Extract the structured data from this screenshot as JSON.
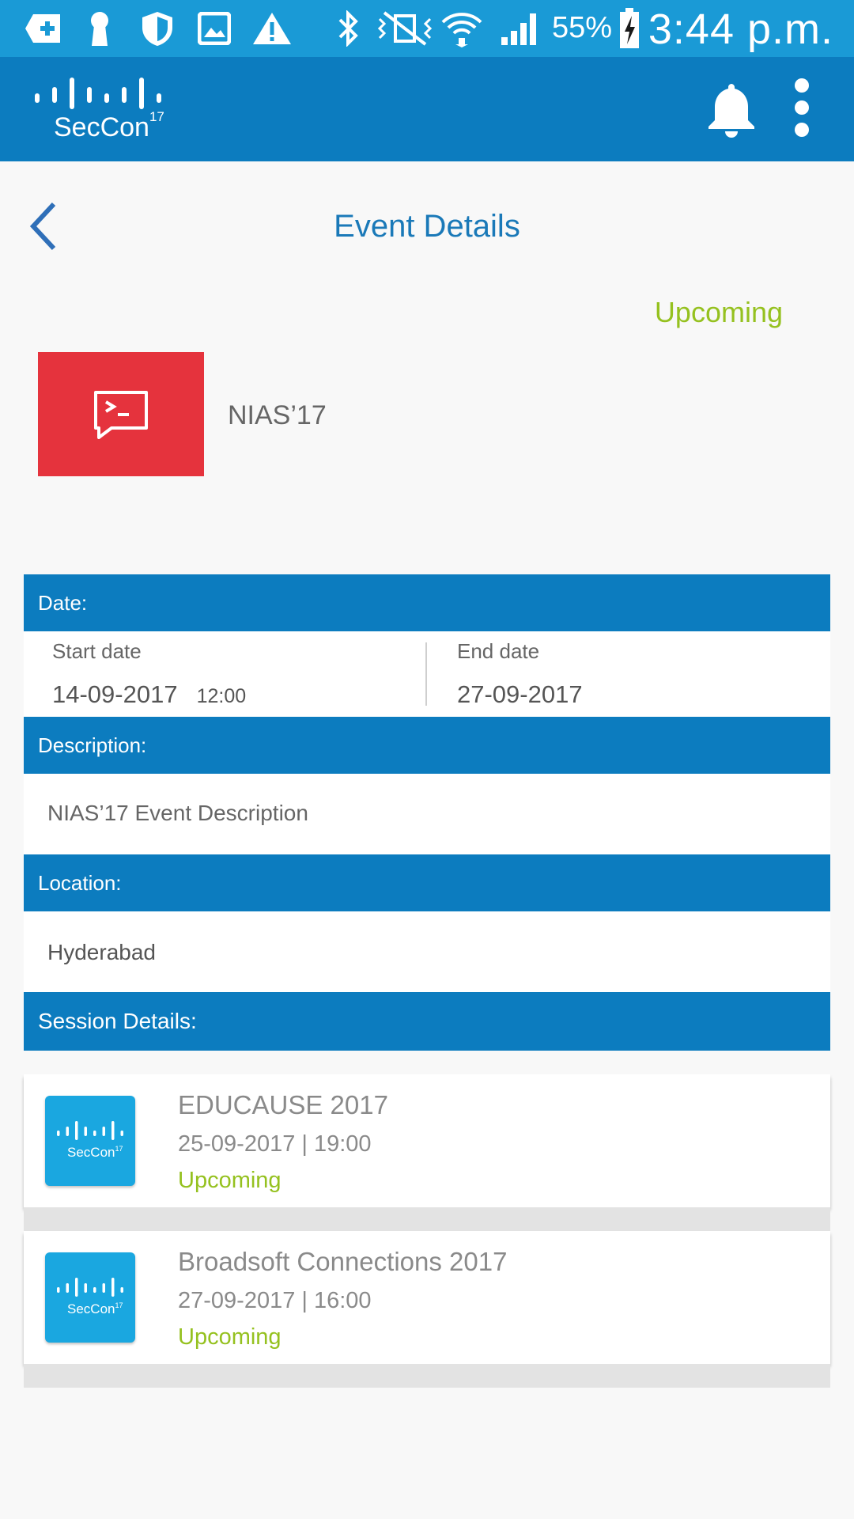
{
  "status_bar": {
    "battery_percent": "55%",
    "time": "3:44 p.m.",
    "icons": [
      "add-box-icon",
      "keyhole-icon",
      "shield-icon",
      "image-icon",
      "warning-icon",
      "bluetooth-icon",
      "vibrate-mute-icon",
      "wifi-icon",
      "signal-icon",
      "battery-charging-icon"
    ]
  },
  "app_bar": {
    "logo_text": "SecCon",
    "logo_superscript": "17",
    "icons": [
      "bell-icon",
      "more-vert-icon"
    ]
  },
  "page": {
    "title": "Event Details",
    "status": "Upcoming"
  },
  "event": {
    "name": "NIAS’17",
    "thumb_color": "#e5333d"
  },
  "date_section": {
    "header": "Date:",
    "start_label": "Start date",
    "start_date": "14-09-2017",
    "start_time": "12:00",
    "end_label": "End date",
    "end_date": "27-09-2017"
  },
  "description_section": {
    "header": "Description:",
    "text": "NIAS’17 Event Description"
  },
  "location_section": {
    "header": "Location:",
    "text": "Hyderabad"
  },
  "session_section": {
    "header": "Session Details:"
  },
  "sessions": [
    {
      "title": "EDUCAUSE 2017",
      "datetime": "25-09-2017 | 19:00",
      "status": "Upcoming",
      "logo_text": "SecCon",
      "logo_sup": "17"
    },
    {
      "title": "Broadsoft Connections 2017",
      "datetime": "27-09-2017 | 16:00",
      "status": "Upcoming",
      "logo_text": "SecCon",
      "logo_sup": "17"
    }
  ],
  "colors": {
    "status_bar": "#1a9ad6",
    "app_bar": "#0c7cbf",
    "accent_green": "#95c11f",
    "title_blue": "#1a79b8"
  }
}
